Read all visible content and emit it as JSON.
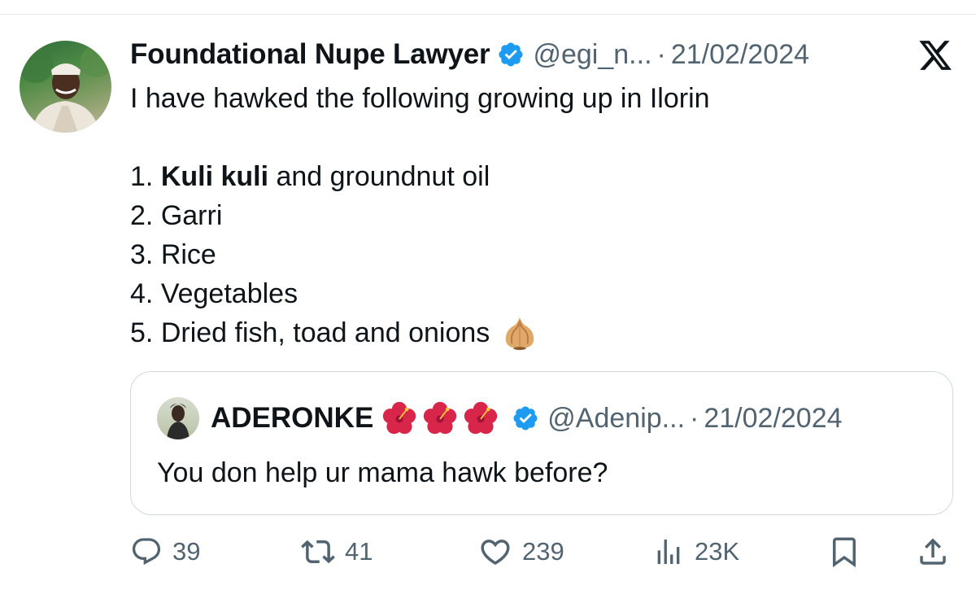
{
  "tweet": {
    "author_name": "Foundational Nupe Lawyer",
    "handle": "@egi_n...",
    "separator": "·",
    "date": "21/02/2024",
    "intro": "I have hawked the following growing up in Ilorin",
    "items": [
      {
        "prefix": "1. ",
        "bold": "Kuli kuli",
        "rest": " and groundnut oil"
      },
      {
        "prefix": "2. ",
        "bold": "",
        "rest": "Garri"
      },
      {
        "prefix": "3. ",
        "bold": "",
        "rest": "Rice"
      },
      {
        "prefix": "4. ",
        "bold": "",
        "rest": "Vegetables"
      },
      {
        "prefix": "5. ",
        "bold": "",
        "rest": "Dried fish, toad and onions"
      }
    ]
  },
  "quoted": {
    "author_name": "ADERONKE",
    "handle": "@Adenip...",
    "separator": "·",
    "date": "21/02/2024",
    "text": "You don help ur mama hawk before?"
  },
  "actions": {
    "replies": "39",
    "reposts": "41",
    "likes": "239",
    "views": "23K"
  },
  "colors": {
    "verified_blue": "#1d9bf0",
    "muted_text": "#536471",
    "primary_text": "#0f1419"
  }
}
